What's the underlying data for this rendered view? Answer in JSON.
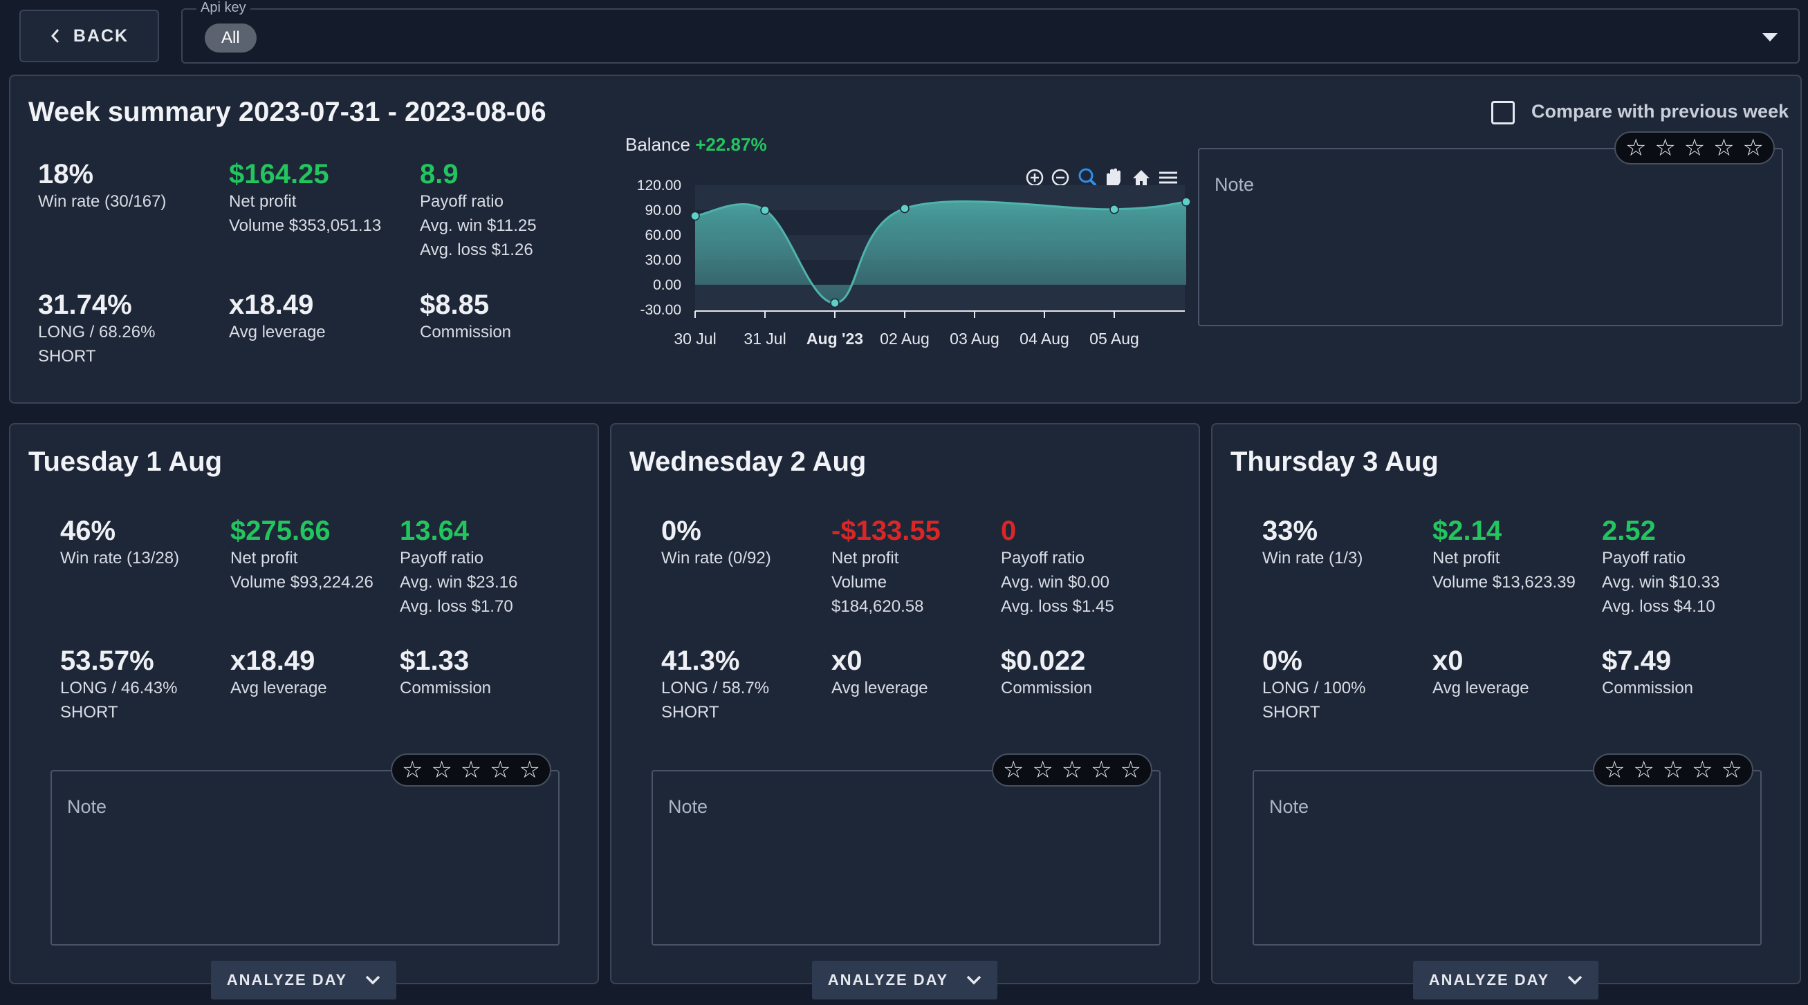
{
  "topbar": {
    "back_label": "BACK",
    "api_key_label": "Api key",
    "api_key_value": "All"
  },
  "week": {
    "title": "Week summary 2023-07-31 - 2023-08-06",
    "compare_label": "Compare with previous week",
    "win_rate": "18%",
    "win_rate_label": "Win rate (30/167)",
    "net_profit": "$164.25",
    "net_profit_label": "Net profit",
    "volume": "Volume $353,051.13",
    "payoff": "8.9",
    "payoff_label": "Payoff ratio",
    "avg_win": "Avg. win $11.25",
    "avg_loss": "Avg. loss $1.26",
    "long_short": "31.74%",
    "long_short_label_1": "LONG / 68.26%",
    "long_short_label_2": "SHORT",
    "leverage": "x18.49",
    "leverage_label": "Avg leverage",
    "commission": "$8.85",
    "commission_label": "Commission",
    "note_placeholder": "Note",
    "rating": 0
  },
  "chart_data": {
    "type": "area",
    "title": "Balance",
    "title_value": "+22.87%",
    "x": [
      "30 Jul",
      "31 Jul",
      "Aug '23",
      "02 Aug",
      "03 Aug",
      "04 Aug",
      "05 Aug"
    ],
    "y_ticks": [
      "120.00",
      "90.00",
      "60.00",
      "30.00",
      "0.00",
      "-30.00"
    ],
    "ylim": [
      -30,
      120
    ],
    "points": [
      {
        "x": "30 Jul",
        "y": 83
      },
      {
        "x": "31 Jul",
        "y": 90
      },
      {
        "x": "Aug '23",
        "y": -22
      },
      {
        "x": "02 Aug",
        "y": 92
      },
      {
        "x": "05 Aug",
        "y": 91
      },
      {
        "x": "end",
        "y": 100
      }
    ],
    "color": "#4fb3ad",
    "toolbar": [
      "zoom-in-icon",
      "zoom-out-icon",
      "selection-zoom-icon",
      "pan-icon",
      "reset-home-icon",
      "menu-icon"
    ]
  },
  "days": [
    {
      "title": "Tuesday 1 Aug",
      "win_rate": "46%",
      "win_rate_label": "Win rate (13/28)",
      "net_profit": "$275.66",
      "net_profit_label": "Net profit",
      "volume_1": "Volume $93,224.26",
      "volume_2": "",
      "payoff": "13.64",
      "payoff_label": "Payoff ratio",
      "avg_win": "Avg. win $23.16",
      "avg_loss": "Avg. loss $1.70",
      "long_short": "53.57%",
      "long_short_label_1": "LONG / 46.43%",
      "long_short_label_2": "SHORT",
      "leverage": "x18.49",
      "leverage_label": "Avg leverage",
      "commission": "$1.33",
      "commission_label": "Commission",
      "note_placeholder": "Note",
      "analyze_label": "ANALYZE DAY"
    },
    {
      "title": "Wednesday 2 Aug",
      "win_rate": "0%",
      "win_rate_label": "Win rate (0/92)",
      "net_profit": "-$133.55",
      "net_profit_label": "Net profit",
      "volume_1": "Volume",
      "volume_2": "$184,620.58",
      "payoff": "0",
      "payoff_label": "Payoff ratio",
      "avg_win": "Avg. win $0.00",
      "avg_loss": "Avg. loss $1.45",
      "long_short": "41.3%",
      "long_short_label_1": "LONG / 58.7%",
      "long_short_label_2": "SHORT",
      "leverage": "x0",
      "leverage_label": "Avg leverage",
      "commission": "$0.022",
      "commission_label": "Commission",
      "note_placeholder": "Note",
      "analyze_label": "ANALYZE DAY"
    },
    {
      "title": "Thursday 3 Aug",
      "win_rate": "33%",
      "win_rate_label": "Win rate (1/3)",
      "net_profit": "$2.14",
      "net_profit_label": "Net profit",
      "volume_1": "Volume $13,623.39",
      "volume_2": "",
      "payoff": "2.52",
      "payoff_label": "Payoff ratio",
      "avg_win": "Avg. win $10.33",
      "avg_loss": "Avg. loss $4.10",
      "long_short": "0%",
      "long_short_label_1": "LONG / 100%",
      "long_short_label_2": "SHORT",
      "leverage": "x0",
      "leverage_label": "Avg leverage",
      "commission": "$7.49",
      "commission_label": "Commission",
      "note_placeholder": "Note",
      "analyze_label": "ANALYZE DAY"
    }
  ],
  "colors": {
    "positive": "#22c55e",
    "negative": "#dc2626",
    "background": "#141c2b",
    "panel": "#1e2738"
  }
}
